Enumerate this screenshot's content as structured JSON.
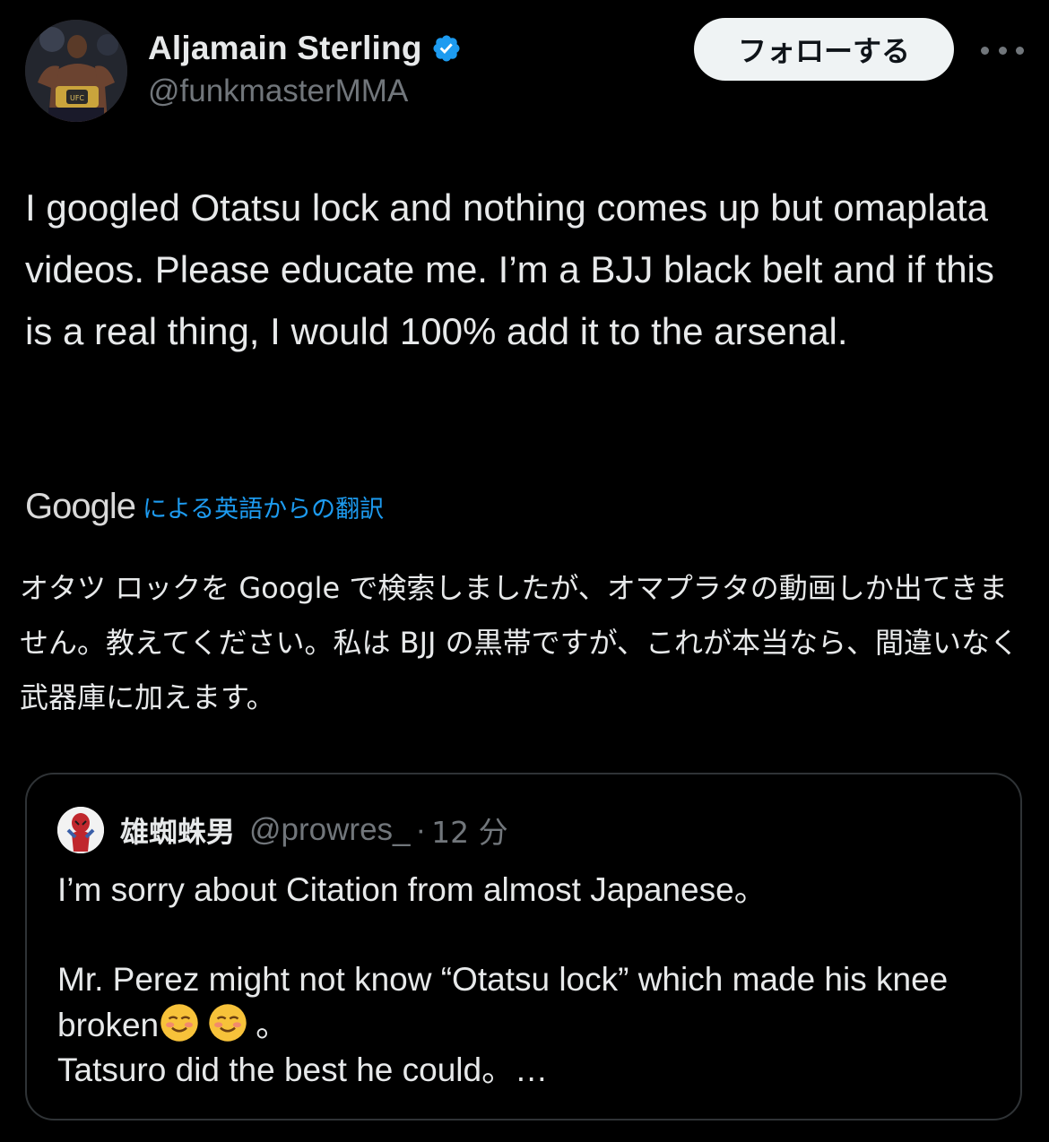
{
  "author": {
    "display_name": "Aljamain Sterling",
    "handle": "@funkmasterMMA",
    "verified": true,
    "follow_label": "フォローする"
  },
  "tweet": {
    "text": "I googled Otatsu lock and nothing comes up but omaplata videos. Please educate me. I’m a BJJ black belt and if this is a real thing, I would 100% add it to the arsenal."
  },
  "translation": {
    "provider": "Google",
    "label": "による英語からの翻訳",
    "text": "オタツ ロックを Google で検索しましたが、オマプラタの動画しか出てきません。教えてください。私は BJJ の黒帯ですが、これが本当なら、間違いなく武器庫に加えます。"
  },
  "quote": {
    "display_name": "雄蜘蛛男",
    "handle": "@prowres_",
    "dot": "·",
    "time": "12 分",
    "line1": "I’m sorry about Citation from almost Japanese。",
    "line2": "Mr. Perez might not know “Otatsu lock” which made his knee broken",
    "line2_end": "。",
    "line3": "Tatsuro did the best he could。…"
  },
  "colors": {
    "background": "#000000",
    "text": "#e7e9ea",
    "secondary": "#71767b",
    "link": "#1d9bf0",
    "verified": "#1d9bf0",
    "border": "#2f3336"
  },
  "icons": {
    "verified": "verified-badge-icon",
    "more": "more-dots-icon",
    "emoji": "smiling-face-emoji"
  }
}
